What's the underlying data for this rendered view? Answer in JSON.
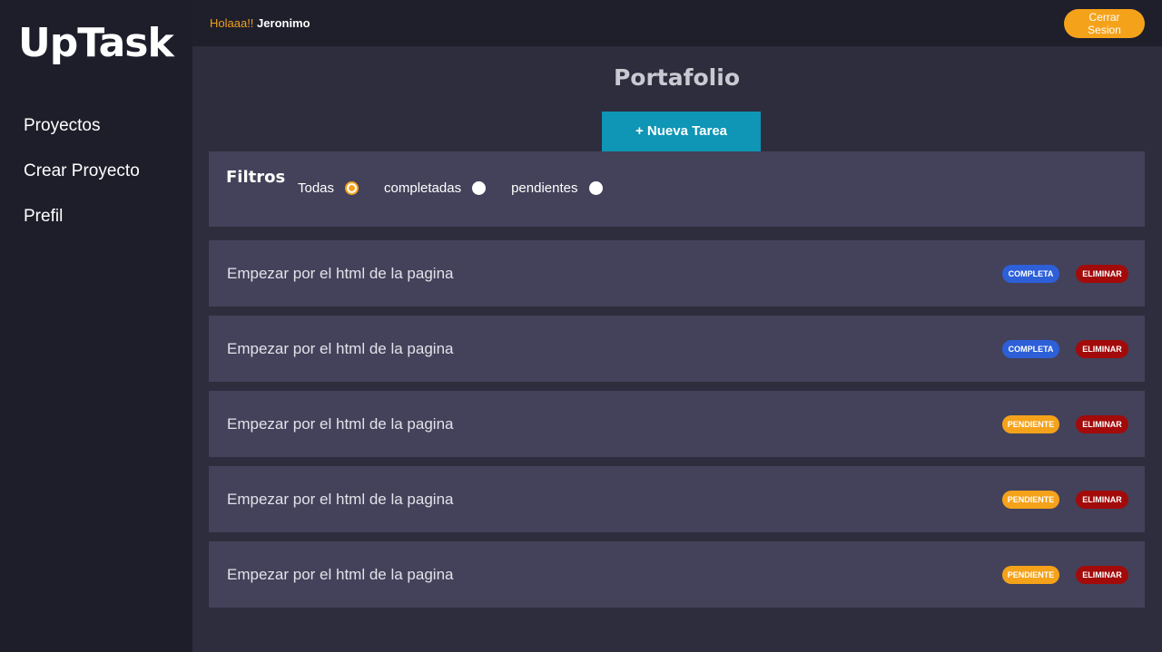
{
  "sidebar": {
    "logo": "UpTask",
    "items": [
      {
        "label": "Proyectos"
      },
      {
        "label": "Crear Proyecto"
      },
      {
        "label": "Prefil"
      }
    ]
  },
  "topbar": {
    "greeting": "Holaaa!!",
    "user": "Jeronimo",
    "logout_label": "Cerrar Sesion"
  },
  "project": {
    "title": "Portafolio",
    "new_task_label": "+ Nueva Tarea"
  },
  "filters": {
    "title": "Filtros",
    "options": [
      {
        "label": "Todas",
        "checked": true
      },
      {
        "label": "completadas",
        "checked": false
      },
      {
        "label": "pendientes",
        "checked": false
      }
    ]
  },
  "tasks": [
    {
      "name": "Empezar por el html de la pagina",
      "status": "COMPLETA",
      "delete": "ELIMINAR"
    },
    {
      "name": "Empezar por el html de la pagina",
      "status": "COMPLETA",
      "delete": "ELIMINAR"
    },
    {
      "name": "Empezar por el html de la pagina",
      "status": "PENDIENTE",
      "delete": "ELIMINAR"
    },
    {
      "name": "Empezar por el html de la pagina",
      "status": "PENDIENTE",
      "delete": "ELIMINAR"
    },
    {
      "name": "Empezar por el html de la pagina",
      "status": "PENDIENTE",
      "delete": "ELIMINAR"
    }
  ],
  "colors": {
    "accent": "#f5a21b",
    "primary_button": "#0f95b5",
    "complete": "#2d5fd9",
    "delete": "#a30a0a"
  }
}
